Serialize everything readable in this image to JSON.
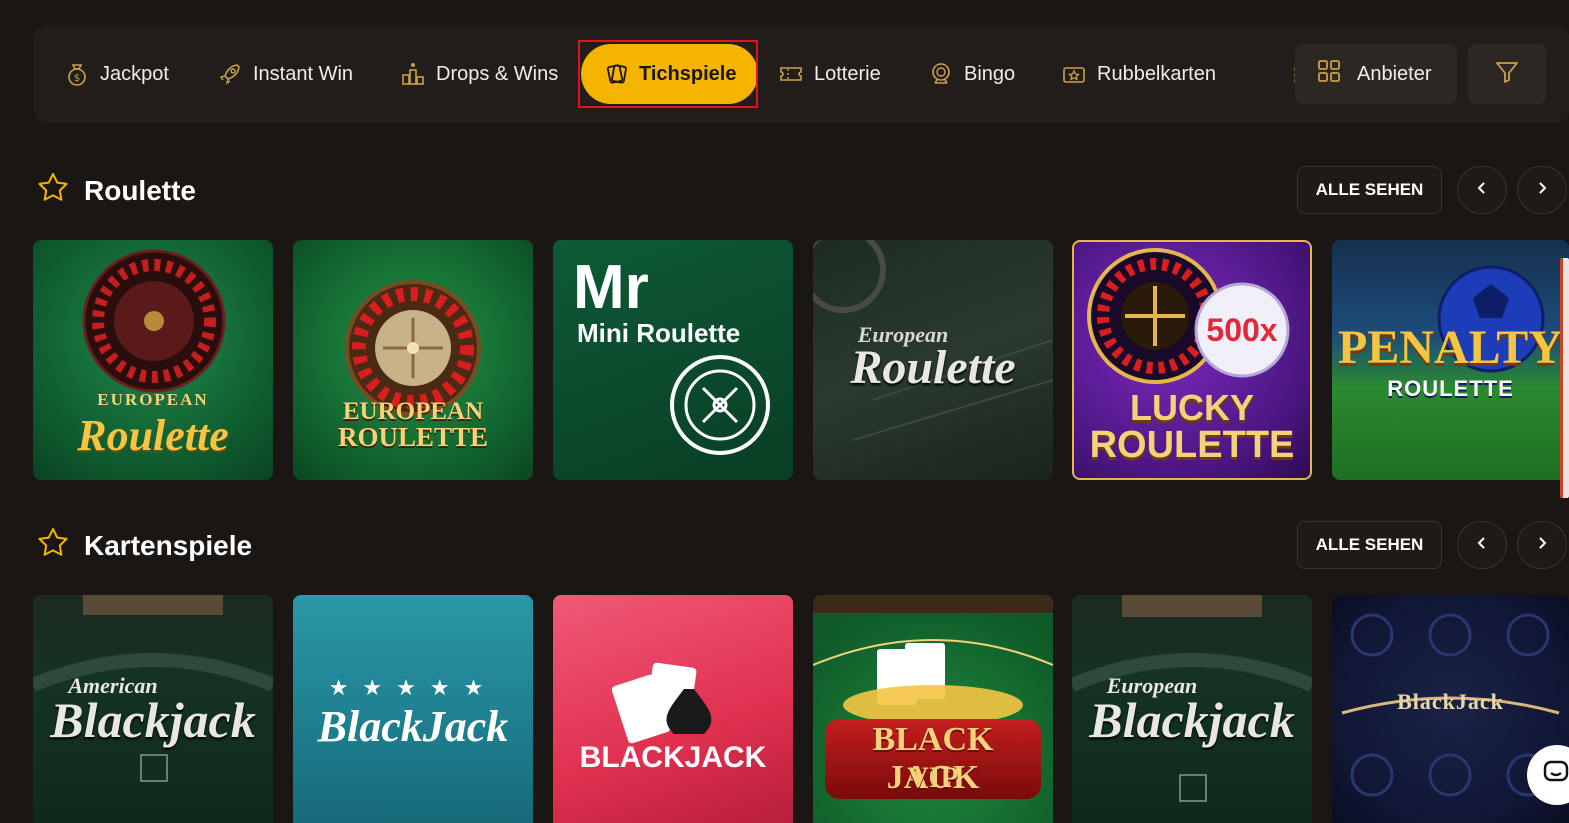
{
  "nav": {
    "categories": [
      {
        "label": "Jackpot",
        "icon": "money-bag-icon"
      },
      {
        "label": "Instant Win",
        "icon": "rocket-icon"
      },
      {
        "label": "Drops & Wins",
        "icon": "podium-icon"
      },
      {
        "label": "Tichspiele",
        "icon": "cards-icon",
        "active": true
      },
      {
        "label": "Lotterie",
        "icon": "ticket-icon"
      },
      {
        "label": "Bingo",
        "icon": "bingo-ball-icon"
      },
      {
        "label": "Rubbelkarten",
        "icon": "scratch-card-icon"
      }
    ],
    "providers_label": "Anbieter",
    "providers_icon": "grid-icon",
    "filter_icon": "filter-icon",
    "accent_color": "#f4b400",
    "highlight_color": "#e0141f"
  },
  "sections": [
    {
      "title": "Roulette",
      "see_all": "ALLE SEHEN",
      "games": [
        {
          "line1": "EUROPEAN",
          "line2": "Roulette"
        },
        {
          "line1": "EUROPEAN",
          "line2": "ROULETTE"
        },
        {
          "line1": "Mr",
          "line2": "Mini Roulette"
        },
        {
          "line1": "European",
          "line2": "Roulette"
        },
        {
          "line1": "500x",
          "line2": "LUCKY",
          "line3": "ROULETTE"
        },
        {
          "line1": "PENALTY",
          "line2": "ROULETTE"
        }
      ]
    },
    {
      "title": "Kartenspiele",
      "see_all": "ALLE SEHEN",
      "games": [
        {
          "line1": "American",
          "line2": "Blackjack"
        },
        {
          "line1": "BlackJack"
        },
        {
          "line1": "BLACKJACK"
        },
        {
          "line1": "BLACK JACK",
          "line2": "VIP"
        },
        {
          "line1": "European",
          "line2": "Blackjack"
        },
        {
          "line1": "BlackJack"
        }
      ]
    }
  ]
}
